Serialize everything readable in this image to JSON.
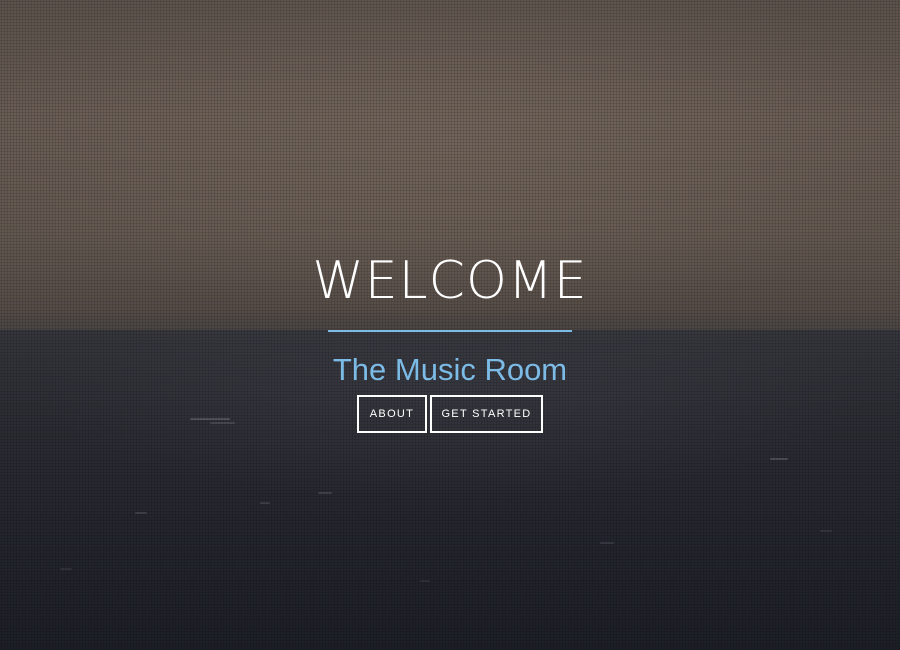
{
  "hero": {
    "title": "WELCOME",
    "subtitle": "The Music Room",
    "accent_color": "#7bbbe6",
    "buttons": {
      "about_label": "ABOUT",
      "get_started_label": "GET STARTED"
    }
  }
}
